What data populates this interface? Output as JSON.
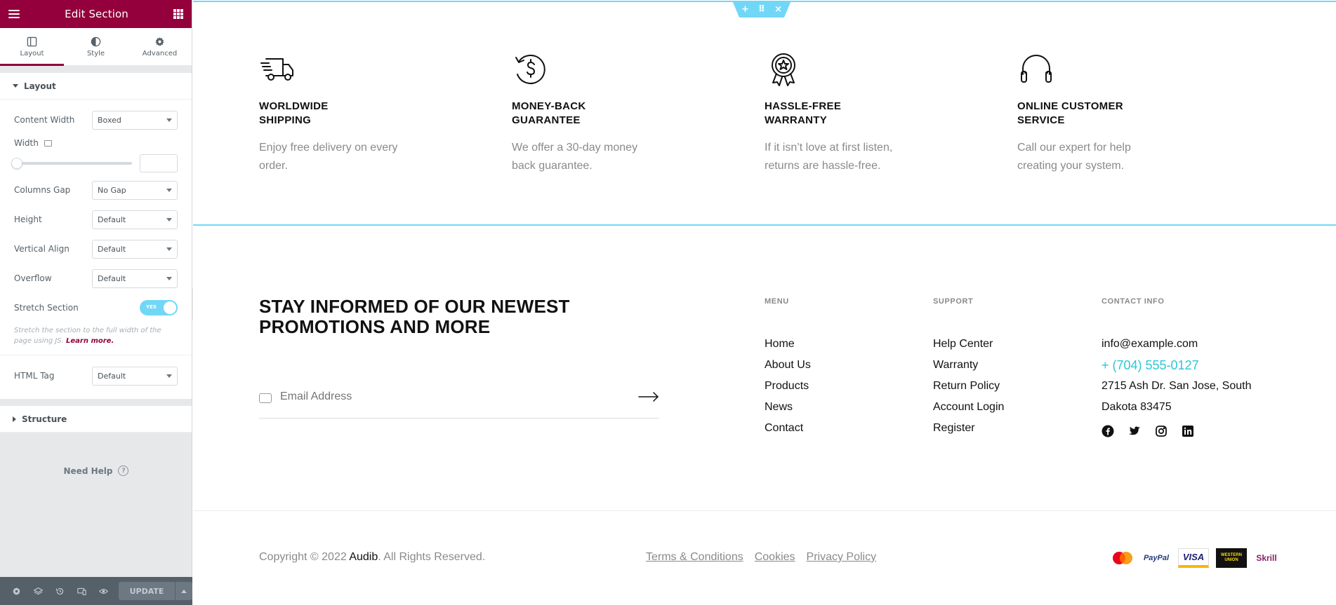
{
  "editor": {
    "title": "Edit Section",
    "tabs": [
      {
        "label": "Layout",
        "icon": "layout-icon"
      },
      {
        "label": "Style",
        "icon": "contrast-icon"
      },
      {
        "label": "Advanced",
        "icon": "gear-icon"
      }
    ],
    "layout_section": {
      "heading": "Layout",
      "content_width": {
        "label": "Content Width",
        "value": "Boxed"
      },
      "width": {
        "label": "Width",
        "value": ""
      },
      "columns_gap": {
        "label": "Columns Gap",
        "value": "No Gap"
      },
      "height": {
        "label": "Height",
        "value": "Default"
      },
      "vertical_align": {
        "label": "Vertical Align",
        "value": "Default"
      },
      "overflow": {
        "label": "Overflow",
        "value": "Default"
      },
      "stretch_section": {
        "label": "Stretch Section",
        "toggle_text": "YES",
        "enabled": true
      },
      "stretch_help": "Stretch the section to the full width of the page using JS.",
      "learn_more": "Learn more.",
      "html_tag": {
        "label": "HTML Tag",
        "value": "Default"
      }
    },
    "structure_heading": "Structure",
    "need_help": "Need Help",
    "update_label": "UPDATE",
    "colors": {
      "brand": "#93003c",
      "selection": "#71d7f7"
    }
  },
  "preview": {
    "section_controls": [
      "+",
      "⠿",
      "×"
    ],
    "features": [
      {
        "icon": "truck-icon",
        "title_line1": "WORLDWIDE",
        "title_line2": "SHIPPING",
        "text": "Enjoy free delivery on every order."
      },
      {
        "icon": "money-back-icon",
        "title_line1": "MONEY-BACK",
        "title_line2": "GUARANTEE",
        "text": "We offer a 30-day money back guarantee."
      },
      {
        "icon": "award-icon",
        "title_line1": "HASSLE-FREE",
        "title_line2": "WARRANTY",
        "text": "If it isn’t love at first listen, returns are hassle-free."
      },
      {
        "icon": "headphones-icon",
        "title_line1": "ONLINE CUSTOMER",
        "title_line2": "SERVICE",
        "text": "Call our expert for help creating your system."
      }
    ],
    "newsletter": {
      "title_line1": "STAY INFORMED OF OUR NEWEST",
      "title_line2": "PROMOTIONS AND MORE",
      "placeholder": "Email Address"
    },
    "menu": {
      "heading": "MENU",
      "items": [
        "Home",
        "About Us",
        "Products",
        "News",
        "Contact"
      ]
    },
    "support": {
      "heading": "SUPPORT",
      "items": [
        "Help Center",
        "Warranty",
        "Return Policy",
        "Account Login",
        "Register"
      ]
    },
    "contact": {
      "heading": "CONTACT INFO",
      "email": "info@example.com",
      "phone": "+ (704) 555-0127",
      "address_line1": "2715 Ash Dr. San Jose, South",
      "address_line2": "Dakota 83475",
      "socials": [
        "facebook-icon",
        "twitter-icon",
        "instagram-icon",
        "linkedin-icon"
      ]
    },
    "copyright_prefix": "Copyright © 2022 ",
    "copyright_brand": "Audib",
    "copyright_suffix": ". All Rights Reserved.",
    "legal_links": [
      "Terms & Conditions",
      "Cookies",
      "Privacy Policy"
    ],
    "payments": [
      "mastercard-icon",
      "PayPal",
      "VISA",
      "WESTERN UNION",
      "Skrill"
    ],
    "accent_color": "#2cc6d8"
  }
}
